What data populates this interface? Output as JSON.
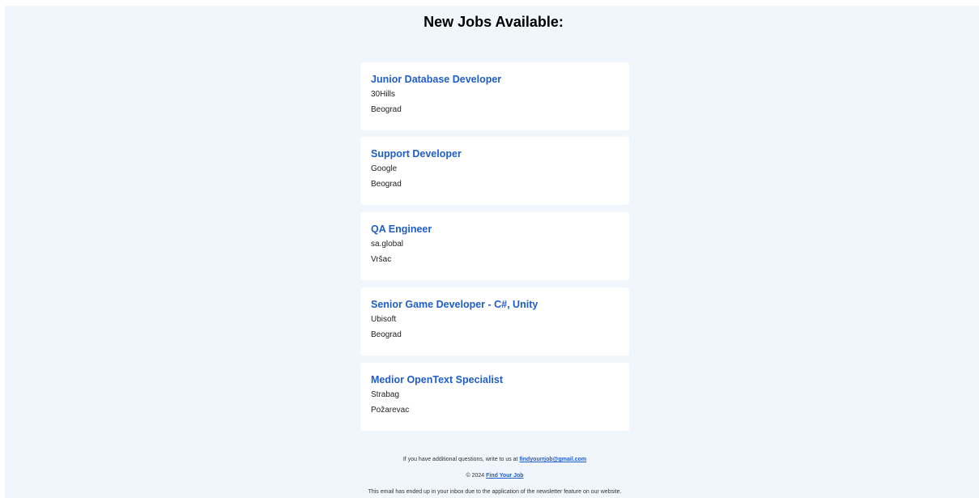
{
  "header": {
    "title": "New Jobs Available:"
  },
  "jobs": [
    {
      "title": "Junior Database Developer",
      "company": "30Hills",
      "location": "Beograd"
    },
    {
      "title": "Support Developer",
      "company": "Google",
      "location": "Beograd"
    },
    {
      "title": "QA Engineer",
      "company": "sa.global",
      "location": "Vršac"
    },
    {
      "title": "Senior Game Developer - C#, Unity",
      "company": "Ubisoft",
      "location": "Beograd"
    },
    {
      "title": "Medior OpenText Specialist",
      "company": "Strabag",
      "location": "Požarevac"
    }
  ],
  "footer": {
    "contact_prefix": "If you have additional questions, write to us at",
    "contact_email": "findyourrjob@gmail.com",
    "copyright_prefix": "© 2024",
    "brand_link": "Find Your Job",
    "notice": "This email has ended up in your inbox due to the application of the newsletter feature on our website."
  },
  "colors": {
    "background": "#f1f6fd",
    "card": "#ffffff",
    "link": "#1f5dc9"
  }
}
